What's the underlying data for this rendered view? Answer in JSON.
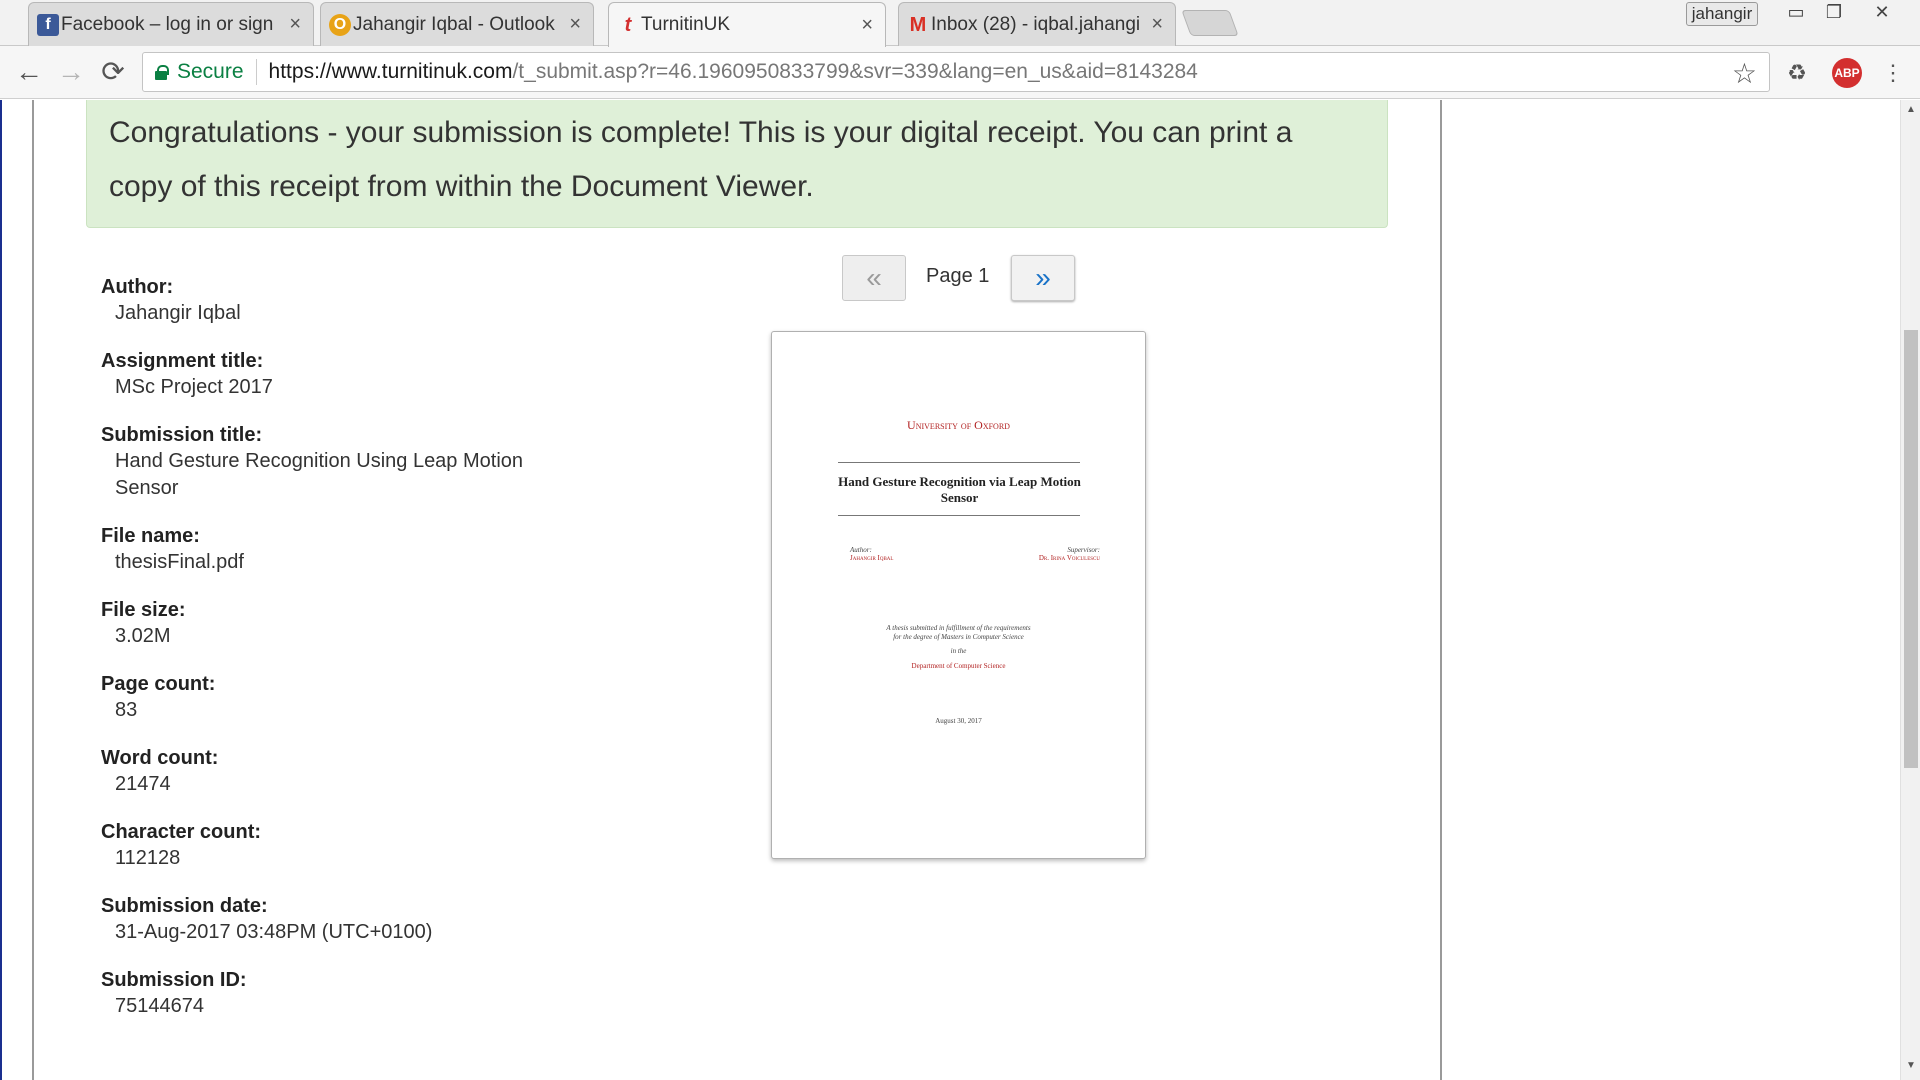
{
  "browser": {
    "tabs": [
      {
        "title": "Facebook – log in or sign",
        "favicon": "f",
        "favicon_color": "#3b5998",
        "active": false
      },
      {
        "title": "Jahangir Iqbal - Outlook",
        "favicon": "O",
        "favicon_color": "#e8a317",
        "active": false
      },
      {
        "title": "TurnitinUK",
        "favicon": "t",
        "favicon_color": "#d32f2f",
        "active": true
      },
      {
        "title": "Inbox (28) - iqbal.jahangi",
        "favicon": "M",
        "favicon_color": "#d93025",
        "active": false
      }
    ],
    "tab_close": "×",
    "profile_name": "jahangir",
    "window_controls": {
      "minimize": "▭",
      "restore": "❐",
      "close": "✕"
    },
    "back": "←",
    "forward": "→",
    "reload": "⟳",
    "secure_label": "Secure",
    "url_host": "https://www.turnitinuk.com",
    "url_path": "/t_submit.asp?r=46.1960950833799&svr=339&lang=en_us&aid=8143284",
    "bookmark_star": "☆",
    "recycle_ext": "♻",
    "abp_label": "ABP",
    "menu": "⋮"
  },
  "page": {
    "banner": "Congratulations - your submission is complete! This is your digital receipt. You can print a copy of this receipt from within the Document Viewer.",
    "fields": [
      {
        "label": "Author:",
        "value": "Jahangir Iqbal"
      },
      {
        "label": "Assignment title:",
        "value": "MSc Project 2017"
      },
      {
        "label": "Submission title:",
        "value": "Hand Gesture Recognition Using Leap Motion Sensor"
      },
      {
        "label": "File name:",
        "value": "thesisFinal.pdf"
      },
      {
        "label": "File size:",
        "value": "3.02M"
      },
      {
        "label": "Page count:",
        "value": "83"
      },
      {
        "label": "Word count:",
        "value": "21474"
      },
      {
        "label": "Character count:",
        "value": "112128"
      },
      {
        "label": "Submission date:",
        "value": "31-Aug-2017 03:48PM (UTC+0100)"
      },
      {
        "label": "Submission ID:",
        "value": "75144674"
      }
    ],
    "pager": {
      "prev": "«",
      "next": "»",
      "label": "Page 1"
    },
    "thumbnail": {
      "university": "University of Oxford",
      "title": "Hand Gesture Recognition via Leap Motion Sensor",
      "author_label": "Author:",
      "author_name": "Jahangir Iqbal",
      "supervisor_label": "Supervisor:",
      "supervisor_name": "Dr. Irina Voiculescu",
      "statement_1": "A thesis submitted in fulfillment of the requirements",
      "statement_2": "for the degree of Masters in Computer Science",
      "statement_3": "in the",
      "department": "Department of Computer Science",
      "date": "August 30, 2017"
    }
  },
  "scrollbar": {
    "up": "▲",
    "down": "▼"
  }
}
